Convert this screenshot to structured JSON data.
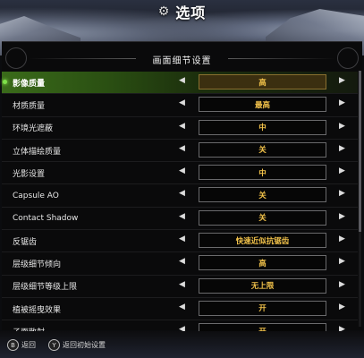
{
  "header": {
    "title": "选项",
    "icon": "gear-icon"
  },
  "panel": {
    "title": "画面细节设置"
  },
  "settings": [
    {
      "label": "影像质量",
      "value": "高",
      "selected": true
    },
    {
      "label": "材质质量",
      "value": "最高"
    },
    {
      "label": "环境光遮蔽",
      "value": "中"
    },
    {
      "label": "立体描绘质量",
      "value": "关"
    },
    {
      "label": "光影设置",
      "value": "中"
    },
    {
      "label": "Capsule AO",
      "value": "关"
    },
    {
      "label": "Contact Shadow",
      "value": "关"
    },
    {
      "label": "反锯齿",
      "value": "快速近似抗锯齿"
    },
    {
      "label": "层级细节倾向",
      "value": "高"
    },
    {
      "label": "层级细节等级上限",
      "value": "无上限"
    },
    {
      "label": "植被摇曳效果",
      "value": "开"
    },
    {
      "label": "子面散射",
      "value": "开"
    }
  ],
  "arrows": {
    "left": "◀",
    "right": "▶"
  },
  "footer": {
    "back_glyph": "B",
    "back_label": "返回",
    "reset_glyph": "Y",
    "reset_label": "返回初始设置"
  },
  "colors": {
    "selected_row": "#3a6b1a",
    "value_text": "#f2c24a"
  }
}
